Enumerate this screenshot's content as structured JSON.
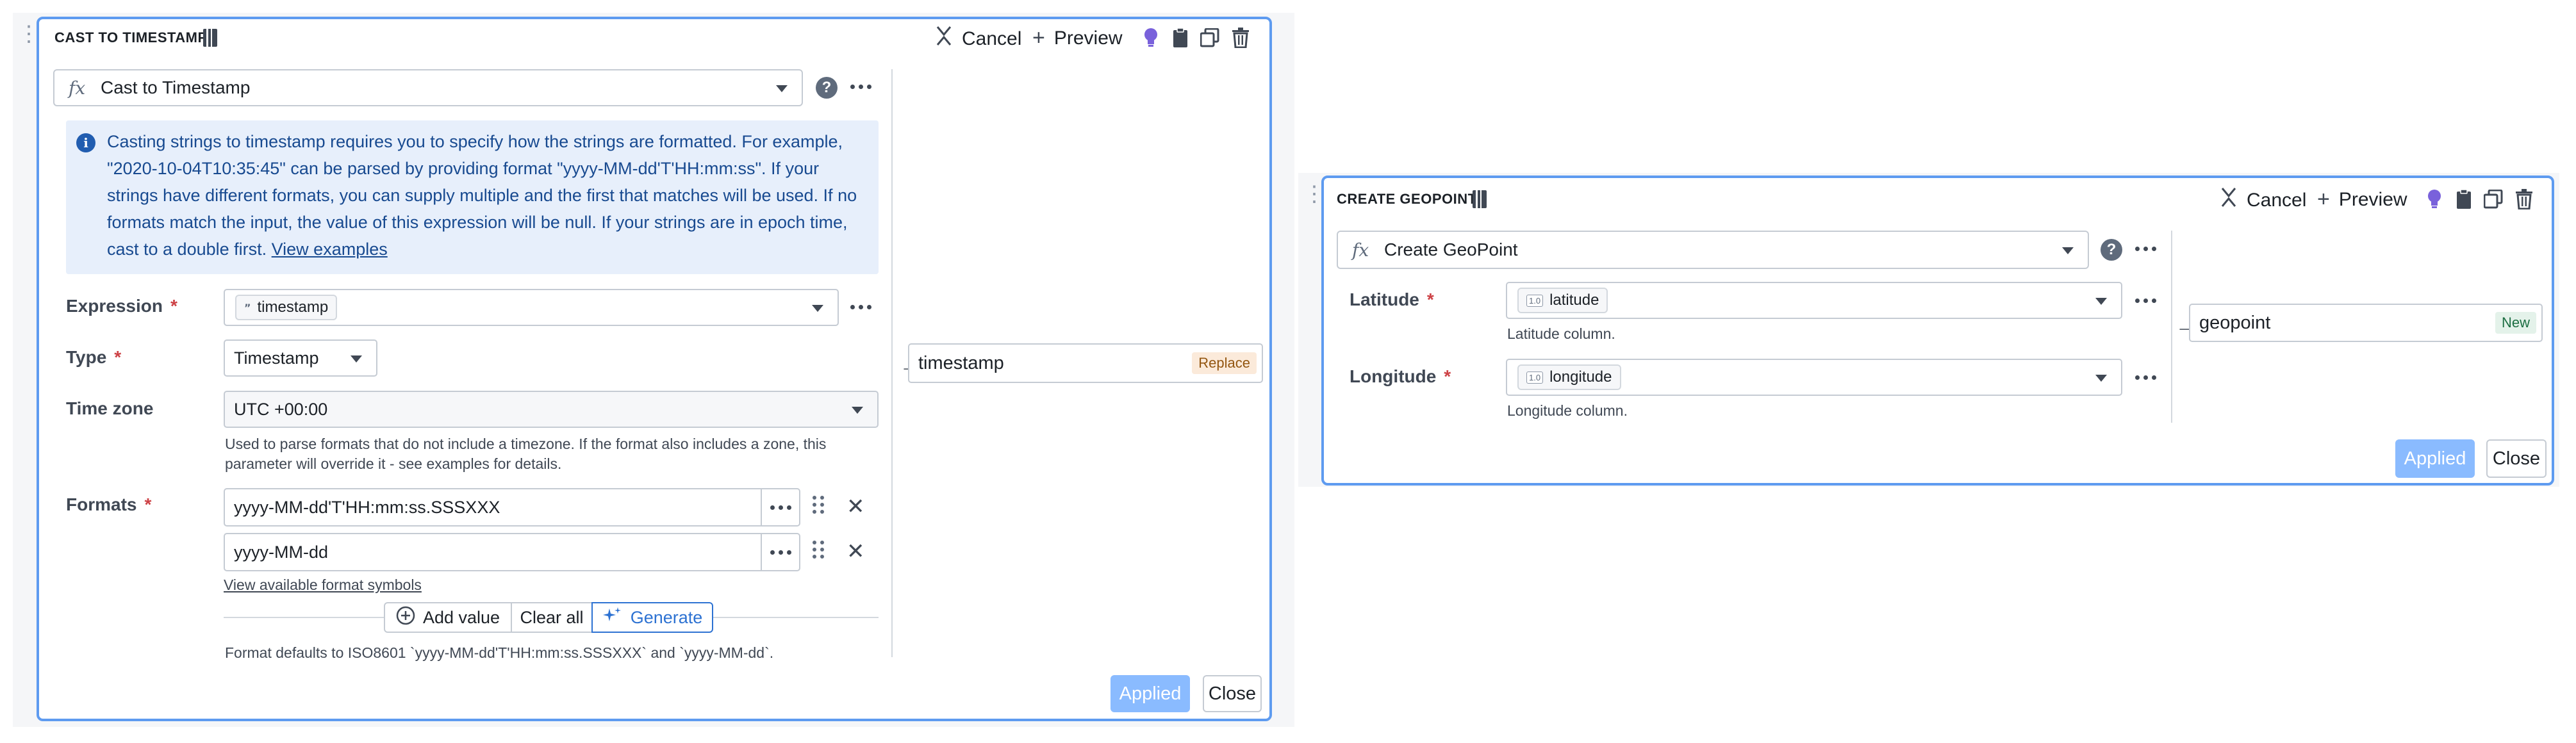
{
  "colors": {
    "panel_border": "#5e9bf0",
    "accent": "#2d72d2",
    "bulb": "#7961db",
    "callout_bg": "#e7effb",
    "callout_text": "#184a90",
    "required": "#cd4246",
    "applied_bg": "#8abbff",
    "replace_bg": "#fbeada",
    "new_bg": "#e4f2ea"
  },
  "left_panel": {
    "title": "CAST TO TIMESTAMP",
    "cancel_label": "Cancel",
    "preview_label": "Preview",
    "function_name": "Cast to Timestamp",
    "info_text": "Casting strings to timestamp requires you to specify how the strings are formatted. For example, \"2020-10-04T10:35:45\" can be parsed by providing format \"yyyy-MM-dd'T'HH:mm:ss\". If your strings have different formats, you can supply multiple and the first that matches will be used. If no formats match the input, the value of this expression will be null. If your strings are in epoch time, cast to a double first. ",
    "info_link": "View examples",
    "expression_label": "Expression",
    "expression_value": "timestamp",
    "type_label": "Type",
    "type_value": "Timestamp",
    "timezone_label": "Time zone",
    "timezone_value": "UTC +00:00",
    "timezone_help": "Used to parse formats that do not include a timezone. If the format also includes a zone, this parameter will override it - see examples for details.",
    "formats_label": "Formats",
    "formats": [
      "yyyy-MM-dd'T'HH:mm:ss.SSSXXX",
      "yyyy-MM-dd"
    ],
    "format_symbols_link": "View available format symbols",
    "add_value_label": "Add value",
    "clear_all_label": "Clear all",
    "generate_label": "Generate",
    "format_default_help": "Format defaults to ISO8601 `yyyy-MM-dd'T'HH:mm:ss.SSSXXX` and `yyyy-MM-dd`.",
    "output_name": "timestamp",
    "output_badge": "Replace",
    "applied_label": "Applied",
    "close_label": "Close"
  },
  "right_panel": {
    "title": "CREATE GEOPOINT",
    "cancel_label": "Cancel",
    "preview_label": "Preview",
    "function_name": "Create GeoPoint",
    "latitude_label": "Latitude",
    "latitude_value": "latitude",
    "latitude_help": "Latitude column.",
    "longitude_label": "Longitude",
    "longitude_value": "longitude",
    "longitude_help": "Longitude column.",
    "type_tag": "1.0",
    "output_name": "geopoint",
    "output_badge": "New",
    "applied_label": "Applied",
    "close_label": "Close"
  },
  "icons": {
    "grip": "drag-handle-icon",
    "notebook": "notebook-icon",
    "cancel": "cancel-icon",
    "preview": "plus-icon",
    "bulb": "lightbulb-icon",
    "clipboard": "clipboard-icon",
    "duplicate": "duplicate-icon",
    "trash": "trash-icon",
    "function": "fx-icon",
    "help": "help-icon",
    "more": "more-icon",
    "info": "info-icon",
    "string_tag": "quote-icon",
    "arrow": "arrow-right-icon",
    "generate": "sparkle-icon",
    "add": "add-circle-icon",
    "remove": "x-icon"
  }
}
